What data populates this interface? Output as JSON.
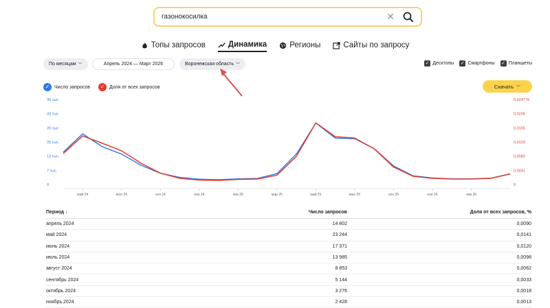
{
  "search": {
    "query": "газонокосилка"
  },
  "tabs": [
    {
      "label": "Топы запросов",
      "icon": "fire-icon"
    },
    {
      "label": "Динамика",
      "icon": "trend-icon"
    },
    {
      "label": "Регионы",
      "icon": "globe-icon"
    },
    {
      "label": "Сайты по запросу",
      "icon": "external-link-icon"
    }
  ],
  "filters": {
    "period_mode": "По месяцам",
    "date_range": "Апрель 2024 — Март 2026",
    "region": "Воронежская область"
  },
  "devices": [
    "Десктопы",
    "Смартфоны",
    "Планшеты"
  ],
  "legend": {
    "count": "Число запросов",
    "share": "Доля от всех запросов"
  },
  "download_label": "Скачать",
  "colors": {
    "count": "#2f7de1",
    "share": "#e8392a",
    "accent": "#fcd34a",
    "annotation_arrow": "#d9534f"
  },
  "chart_data": {
    "type": "line",
    "x": [
      "апр 24",
      "май 24",
      "июн 24",
      "июл 24",
      "авг 24",
      "сен 24",
      "окт 24",
      "ноя 24",
      "дек 24",
      "янв 25",
      "фев 25",
      "мар 25",
      "апр 25",
      "май 25",
      "июн 25",
      "июл 25",
      "авг 25",
      "сен 25",
      "окт 25",
      "ноя 25",
      "дек 25",
      "янв 26",
      "фев 26",
      "мар 26"
    ],
    "x_tick_labels": [
      "май 24",
      "июл 24",
      "сен 24",
      "ноя 24",
      "янв 25",
      "мар 25",
      "май 25",
      "июл 25",
      "сен 25",
      "ноя 25",
      "янв 26"
    ],
    "left_ticks": [
      "39 тыс.",
      "33 тыс.",
      "26 тыс.",
      "20 тыс.",
      "13 тыс.",
      "7 тыс.",
      "0"
    ],
    "right_ticks": [
      "0,0247 %",
      "0,0206",
      "0,0165",
      "0,0123",
      "0,0082",
      "0,0041",
      "0"
    ],
    "left_ylim": [
      0,
      39000
    ],
    "right_ylim": [
      0,
      0.0247
    ],
    "series": [
      {
        "name": "Число запросов",
        "axis": "left",
        "values": [
          14802,
          23244,
          17371,
          13985,
          8853,
          5144,
          3276,
          2428,
          2200,
          2600,
          2800,
          5000,
          14000,
          28200,
          21300,
          21000,
          16500,
          8500,
          4000,
          3000,
          2600,
          2600,
          2900,
          4800
        ]
      },
      {
        "name": "Доля от всех запросов",
        "axis": "right",
        "values": [
          0.009,
          0.0141,
          0.012,
          0.0098,
          0.0062,
          0.0033,
          0.0018,
          0.0013,
          0.0012,
          0.0015,
          0.0016,
          0.0027,
          0.0082,
          0.0179,
          0.0139,
          0.0135,
          0.0104,
          0.0051,
          0.0024,
          0.0018,
          0.0016,
          0.0016,
          0.0018,
          0.0031
        ]
      }
    ]
  },
  "table": {
    "headers": [
      "Период",
      "Число запросов",
      "Доля от всех запросов, %"
    ],
    "rows": [
      [
        "апрель 2024",
        "14 802",
        "0,0090"
      ],
      [
        "май 2024",
        "23 244",
        "0,0141"
      ],
      [
        "июнь 2024",
        "17 371",
        "0,0120"
      ],
      [
        "июль 2024",
        "13 985",
        "0,0098"
      ],
      [
        "август 2024",
        "8 853",
        "0,0062"
      ],
      [
        "сентябрь 2024",
        "5 144",
        "0,0033"
      ],
      [
        "октябрь 2024",
        "3 276",
        "0,0018"
      ],
      [
        "ноябрь 2024",
        "2 428",
        "0,0013"
      ]
    ]
  }
}
